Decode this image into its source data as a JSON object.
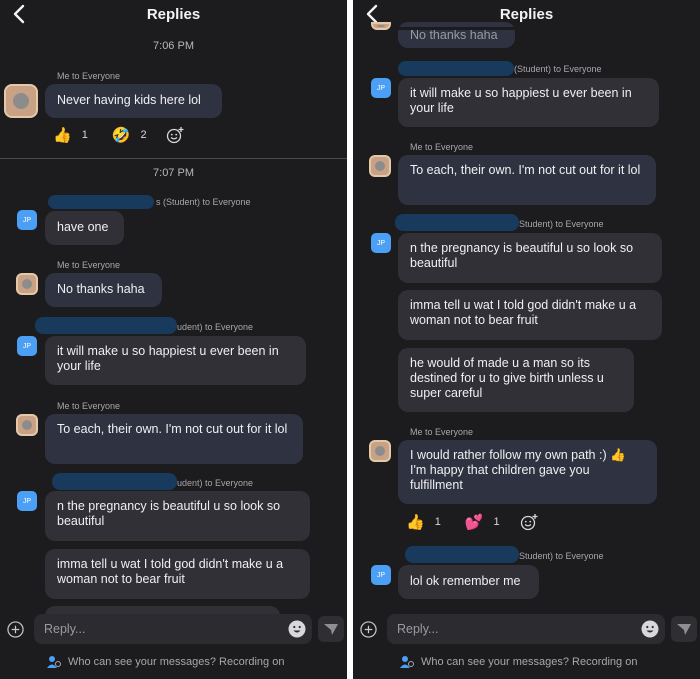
{
  "header": {
    "title": "Replies"
  },
  "left": {
    "times": [
      "7:06 PM",
      "7:07 PM"
    ],
    "messages": [
      {
        "sender": "Me to Everyone",
        "text": "Never having kids here lol"
      },
      {
        "sender": "s (Student) to Everyone",
        "text": "have one"
      },
      {
        "sender": "Me to Everyone",
        "text": "No thanks haha"
      },
      {
        "sender": "udent) to Everyone",
        "text": "it will make u so happiest u ever been in your life"
      },
      {
        "sender": "Me to Everyone",
        "text": "To each, their own. I'm not cut out for it lol"
      },
      {
        "sender": "udent) to Everyone",
        "text": "n the pregnancy is beautiful u so look so beautiful"
      },
      {
        "text": "imma tell u wat I told god didn't make u a woman not to bear fruit"
      }
    ],
    "reactions": [
      {
        "emoji": "👍",
        "count": "1"
      },
      {
        "emoji": "🤣",
        "count": "2"
      }
    ]
  },
  "right": {
    "messages": [
      {
        "text": "No thanks haha"
      },
      {
        "sender": "(Student) to Everyone",
        "text": "it will make u so happiest u ever been in your life"
      },
      {
        "sender": "Me to Everyone",
        "text": "To each, their own. I'm not cut out for it lol"
      },
      {
        "sender": "Student) to Everyone",
        "text": "n the pregnancy is beautiful u so look so beautiful"
      },
      {
        "text": "imma tell u wat I told god didn't make u a woman not to bear fruit"
      },
      {
        "text": "he would of made u a man so its destined for u to give birth unless u super careful"
      },
      {
        "sender": "Me to Everyone",
        "text": "I would rather follow my own path :) 👍 I'm happy that children gave you fulfillment"
      },
      {
        "sender": "Student) to Everyone",
        "text": "lol ok remember me"
      }
    ],
    "reactions": [
      {
        "emoji": "👍",
        "count": "1"
      },
      {
        "emoji": "💕",
        "count": "1"
      }
    ]
  },
  "avatar_initials": "JP",
  "composer": {
    "placeholder": "Reply..."
  },
  "footer": {
    "text": "Who can see your messages? Recording on"
  },
  "colors": {
    "background": "#1c1c1e",
    "bubble": "#303036",
    "avatar": "#4b9ff5",
    "redaction": "#173a5d"
  }
}
